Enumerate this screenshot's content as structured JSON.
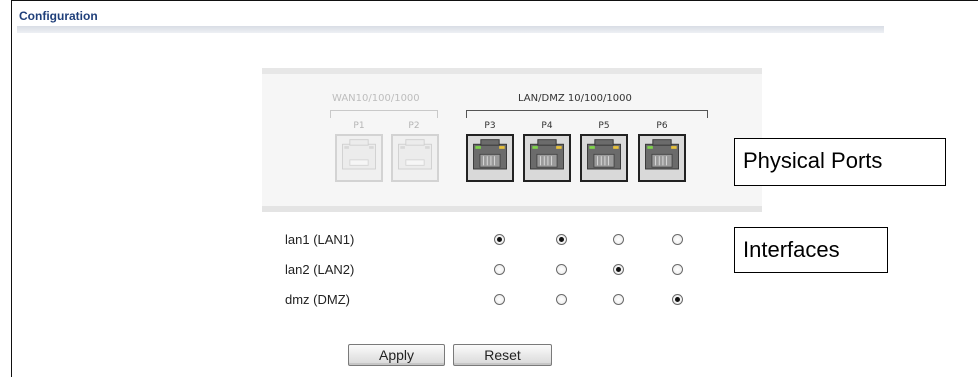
{
  "section": {
    "title": "Configuration"
  },
  "ports_panel": {
    "wan_group_label": "WAN10/100/1000",
    "lan_group_label": "LAN/DMZ  10/100/1000",
    "ports": [
      {
        "label": "P1",
        "state": "inactive"
      },
      {
        "label": "P2",
        "state": "inactive"
      },
      {
        "label": "P3",
        "state": "active"
      },
      {
        "label": "P4",
        "state": "active"
      },
      {
        "label": "P5",
        "state": "active"
      },
      {
        "label": "P6",
        "state": "active"
      }
    ]
  },
  "interfaces": [
    {
      "label": "lan1 (LAN1)",
      "selected": [
        true,
        true,
        false,
        false
      ]
    },
    {
      "label": "lan2 (LAN2)",
      "selected": [
        false,
        false,
        true,
        false
      ]
    },
    {
      "label": "dmz (DMZ)",
      "selected": [
        false,
        false,
        false,
        true
      ]
    }
  ],
  "buttons": {
    "apply_label": "Apply",
    "reset_label": "Reset"
  },
  "callouts": {
    "ports": "Physical Ports",
    "interfaces": "Interfaces"
  },
  "colors": {
    "title": "#1f3f7a",
    "active_border": "#222222",
    "inactive_border": "#d3d3d3"
  }
}
